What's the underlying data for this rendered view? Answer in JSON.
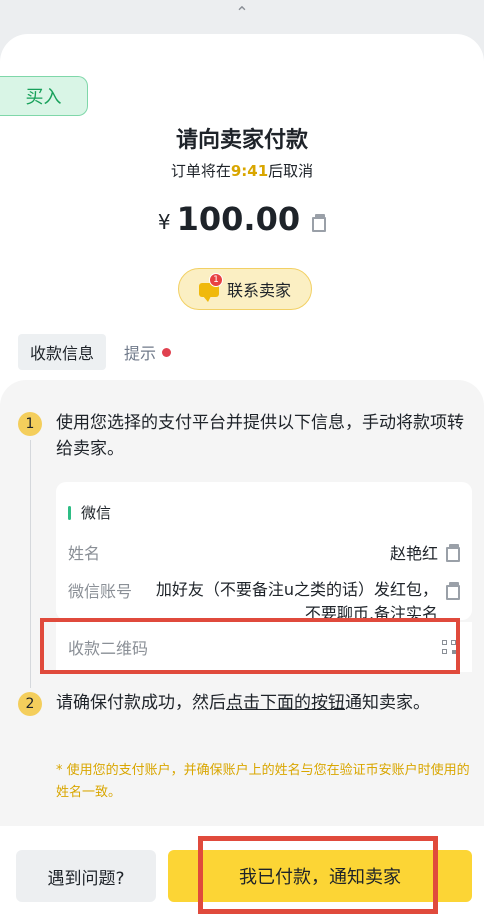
{
  "header": {
    "collapse_icon": "chevron-up-icon",
    "collapse_glyph": "⌃"
  },
  "order": {
    "side_tag": "买入",
    "title": "请向卖家付款",
    "cancel_prefix": "订单将在",
    "cancel_time": "9:41",
    "cancel_suffix": "后取消",
    "currency_symbol": "¥",
    "amount": "100.00"
  },
  "contact": {
    "label": "联系卖家",
    "badge_count": "1"
  },
  "tabs": {
    "active": "收款信息",
    "tips": "提示"
  },
  "step1": {
    "number": "1",
    "text": "使用您选择的支付平台并提供以下信息，手动将款项转给卖家。"
  },
  "payment_card": {
    "method": "微信",
    "name_label": "姓名",
    "name_value": "赵艳红",
    "account_label": "微信账号",
    "account_value": "加好友（不要备注u之类的话）发红包，不要聊币,备注实名",
    "qr_label": "收款二维码"
  },
  "step2": {
    "number": "2",
    "text_before": "请确保付款成功，然后",
    "text_link": "点击下面的按钮",
    "text_after": "通知卖家。"
  },
  "note": "* 使用您的支付账户，并确保账户上的姓名与您在验证币安账户时使用的姓名一致。",
  "buttons": {
    "problem": "遇到问题?",
    "paid": "我已付款，通知卖家"
  },
  "colors": {
    "accent": "#fcd535",
    "buy_green": "#17a05a",
    "highlight": "#e04a3c"
  }
}
